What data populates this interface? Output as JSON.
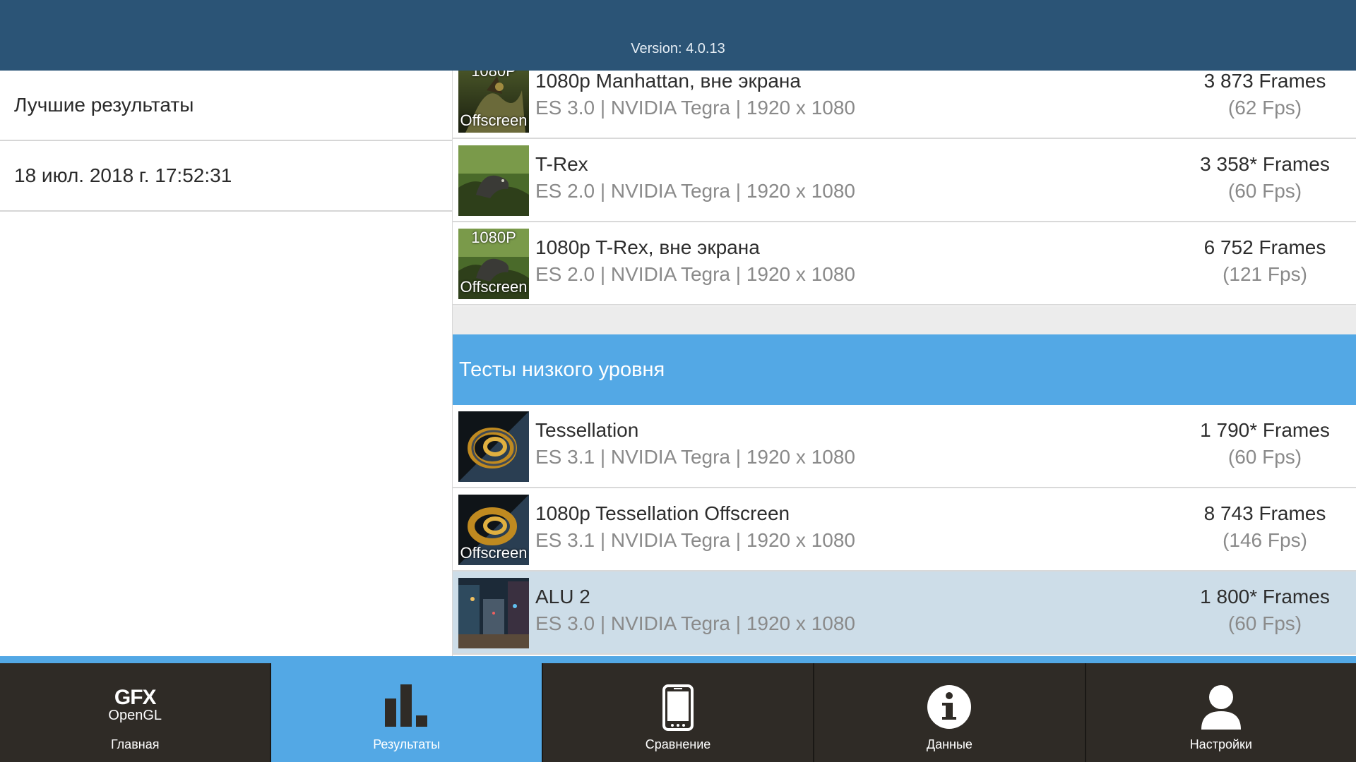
{
  "header": {
    "version": "Version: 4.0.13"
  },
  "left_panel": {
    "items": [
      "Лучшие результаты",
      "18 июл. 2018 г. 17:52:31"
    ]
  },
  "results": {
    "rows": [
      {
        "name": "1080p Manhattan, вне экрана",
        "sub": "ES 3.0 | NVIDIA Tegra | 1920 x 1080",
        "frames": "3 873 Frames",
        "fps": "(62 Fps)",
        "thumb_top": "1080P",
        "thumb_bottom": "Offscreen"
      },
      {
        "name": "T-Rex",
        "sub": "ES 2.0 | NVIDIA Tegra | 1920 x 1080",
        "frames": "3 358* Frames",
        "fps": "(60 Fps)",
        "thumb_top": "",
        "thumb_bottom": ""
      },
      {
        "name": "1080p T-Rex, вне экрана",
        "sub": "ES 2.0 | NVIDIA Tegra | 1920 x 1080",
        "frames": "6 752 Frames",
        "fps": "(121 Fps)",
        "thumb_top": "1080P",
        "thumb_bottom": "Offscreen"
      }
    ],
    "section_title": "Тесты низкого уровня",
    "low_level_rows": [
      {
        "name": "Tessellation",
        "sub": "ES 3.1 | NVIDIA Tegra | 1920 x 1080",
        "frames": "1 790* Frames",
        "fps": "(60 Fps)",
        "thumb_bottom": ""
      },
      {
        "name": "1080p Tessellation Offscreen",
        "sub": "ES 3.1 | NVIDIA Tegra | 1920 x 1080",
        "frames": "8 743 Frames",
        "fps": "(146 Fps)",
        "thumb_bottom": "Offscreen"
      },
      {
        "name": "ALU 2",
        "sub": "ES 3.0 | NVIDIA Tegra | 1920 x 1080",
        "frames": "1 800* Frames",
        "fps": "(60 Fps)",
        "thumb_bottom": "",
        "selected": true
      }
    ]
  },
  "nav": {
    "logo_gfx": "GFX",
    "logo_opengl": "OpenGL",
    "tabs": [
      {
        "label": "Главная",
        "icon": "gfx-logo-icon"
      },
      {
        "label": "Результаты",
        "icon": "bar-chart-icon",
        "active": true
      },
      {
        "label": "Сравнение",
        "icon": "phone-icon"
      },
      {
        "label": "Данные",
        "icon": "info-icon"
      },
      {
        "label": "Настройки",
        "icon": "user-icon"
      }
    ]
  },
  "colors": {
    "header": "#2b5476",
    "accent": "#53a8e5",
    "nav_bg": "#2f2b26",
    "selected_row": "#cddde8"
  }
}
